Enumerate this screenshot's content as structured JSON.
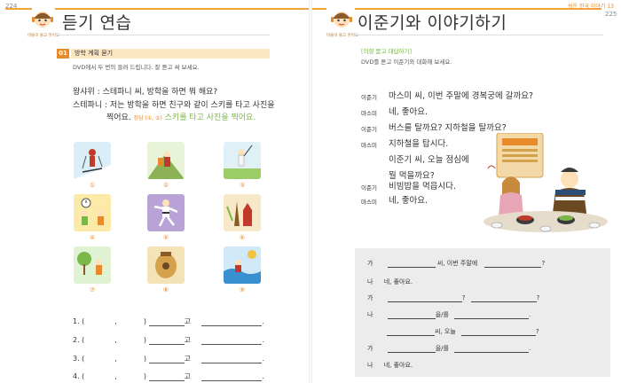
{
  "left_page": {
    "page_number": "224",
    "mascot_caption": "마들이 울고 웃어요",
    "title": "듣기 연습",
    "section": {
      "number": "01",
      "label": "방학 계획 묻기"
    },
    "instruction": "DVD에서 두 번의 들려 드립니다. 잘 듣고 써 보세요.",
    "dialog": {
      "line1": "왕샤위 : 스테파니 씨, 방학을 하면 뭐 해요?",
      "line2": "스테파니 : 저는 방학을 하면 친구와 같이 스키를 타고 사진을",
      "line3": "찍어요.",
      "hint": "정답 (①, ⑤)",
      "hint_answer": "스키를 타고 사진을 찍어요."
    },
    "pictures": [
      "①",
      "②",
      "③",
      "④",
      "⑤",
      "⑥",
      "⑦",
      "⑧",
      "⑨"
    ],
    "answer_rows": [
      {
        "label": "1. (",
        "comma": ",",
        "close": ")",
        "go": "고",
        "end": "."
      },
      {
        "label": "2. (",
        "comma": ",",
        "close": ")",
        "go": "고",
        "end": "."
      },
      {
        "label": "3. (",
        "comma": ",",
        "close": ")",
        "go": "고",
        "end": "."
      },
      {
        "label": "4. (",
        "comma": ",",
        "close": ")",
        "go": "고",
        "end": "."
      }
    ]
  },
  "right_page": {
    "page_number": "225",
    "running_head": "쉬운 한국 이야기 13",
    "mascot_caption": "마들이 울고 웃어요",
    "title": "이준기와 이야기하기",
    "tag": "[의향 묻고 대답하기]",
    "instruction": "DVD를 듣고 이준기와 대화해 보세요.",
    "dialog": [
      {
        "speaker": "이준기",
        "text": "마스미 씨, 이번 주말에 경복궁에 갈까요?"
      },
      {
        "speaker": "마스미",
        "text": "네, 좋아요."
      },
      {
        "speaker": "이준기",
        "text": "버스를 탈까요? 지하철을 탈까요?"
      },
      {
        "speaker": "마스미",
        "text": "지하철을 탑시다."
      },
      {
        "speaker": "",
        "text": "이준기 씨, 오늘 점심에"
      },
      {
        "speaker": "",
        "text": "뭘 먹을까요?"
      },
      {
        "speaker": "이준기",
        "text": "비빔밥을 먹읍시다."
      },
      {
        "speaker": "마스미",
        "text": "네, 좋아요."
      }
    ],
    "practice": [
      {
        "speaker": "가",
        "mid": "씨, 이번 주말에",
        "end": "?"
      },
      {
        "speaker": "나",
        "text": "네, 좋아요."
      },
      {
        "speaker": "가",
        "mid": "?",
        "end": "?"
      },
      {
        "speaker": "나",
        "mid": "을/를",
        "end": "."
      },
      {
        "speaker": "",
        "mid": "씨, 오늘",
        "end": "?"
      },
      {
        "speaker": "가",
        "mid": "을/를",
        "end": "."
      },
      {
        "speaker": "나",
        "text": "네, 좋아요."
      }
    ]
  },
  "colors": {
    "accent": "#e8892a",
    "header_bar": "#f2a23a",
    "hint_green": "#7ab648",
    "practice_bg": "#ececec"
  }
}
